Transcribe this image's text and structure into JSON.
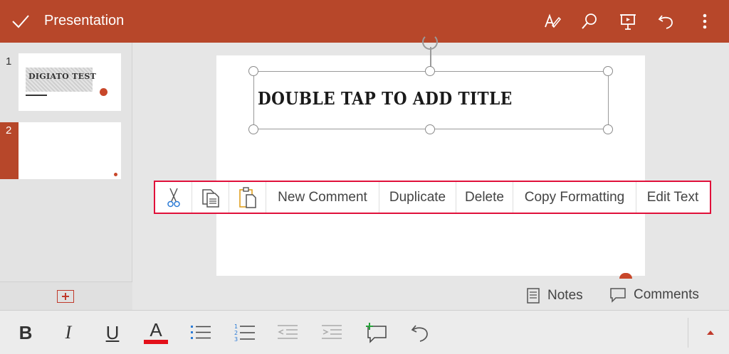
{
  "app": {
    "title": "Presentation"
  },
  "slides": [
    {
      "number": "1",
      "thumbnail_title": "DIGIATO TEST"
    },
    {
      "number": "2",
      "thumbnail_title": ""
    }
  ],
  "slide": {
    "title_placeholder": "DOUBLE TAP TO ADD TITLE"
  },
  "context_menu": {
    "items": [
      {
        "kind": "icon",
        "icon": "scissors-icon"
      },
      {
        "kind": "icon",
        "icon": "copy-icon"
      },
      {
        "kind": "icon",
        "icon": "paste-icon"
      },
      {
        "kind": "text",
        "label": "New Comment"
      },
      {
        "kind": "text",
        "label": "Duplicate"
      },
      {
        "kind": "text",
        "label": "Delete"
      },
      {
        "kind": "text",
        "label": "Copy Formatting"
      },
      {
        "kind": "text",
        "label": "Edit Text"
      }
    ]
  },
  "footer": {
    "notes_label": "Notes",
    "comments_label": "Comments"
  },
  "format_toolbar": {
    "bold": "B",
    "italic": "I",
    "underline": "U",
    "font_color_letter": "A"
  },
  "colors": {
    "accent": "#b7472a",
    "highlight_border": "#e0103a",
    "font_color_bar": "#e3101a",
    "list_icon_blue": "#2b7bd6"
  }
}
